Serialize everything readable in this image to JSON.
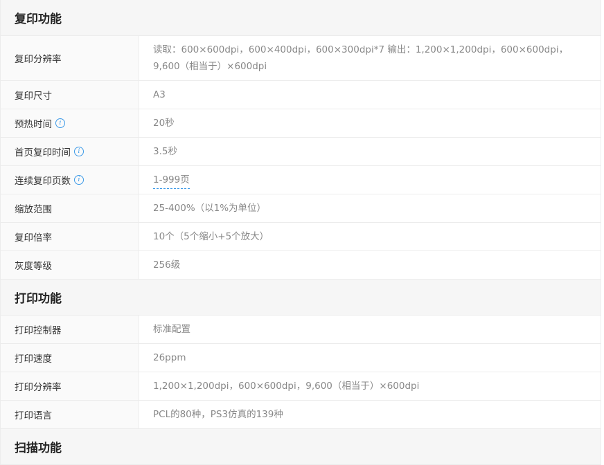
{
  "sections": {
    "copy": {
      "title": "复印功能",
      "rows": [
        {
          "label": "复印分辨率",
          "value": "读取：600×600dpi，600×400dpi，600×300dpi*7 输出：1,200×1,200dpi，600×600dpi，9,600（相当于）×600dpi"
        },
        {
          "label": "复印尺寸",
          "value": "A3"
        },
        {
          "label": "预热时间",
          "value": "20秒",
          "info": true
        },
        {
          "label": "首页复印时间",
          "value": "3.5秒",
          "info": true
        },
        {
          "label": "连续复印页数",
          "value": "1-999页",
          "info": true
        },
        {
          "label": "缩放范围",
          "value": "25-400%（以1%为单位）"
        },
        {
          "label": "复印倍率",
          "value": "10个（5个缩小+5个放大）"
        },
        {
          "label": "灰度等级",
          "value": "256级"
        }
      ]
    },
    "print": {
      "title": "打印功能",
      "rows": [
        {
          "label": "打印控制器",
          "value": "标准配置"
        },
        {
          "label": "打印速度",
          "value": "26ppm"
        },
        {
          "label": "打印分辨率",
          "value": "1,200×1,200dpi，600×600dpi，9,600（相当于）×600dpi"
        },
        {
          "label": "打印语言",
          "value": "PCL的80种，PS3仿真的139种"
        }
      ]
    },
    "scan": {
      "title": "扫描功能"
    }
  },
  "colors": {
    "info_icon": "#3d9ae8",
    "header_bg": "#f6f6f6",
    "label_bg": "#fafafa"
  },
  "icons": {
    "info": "info-circle-icon"
  }
}
